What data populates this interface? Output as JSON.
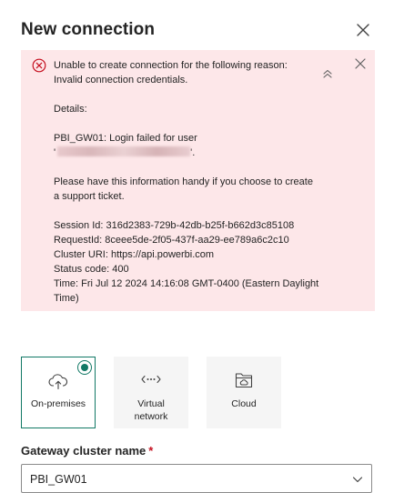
{
  "dialog": {
    "title": "New connection"
  },
  "error": {
    "lines": {
      "l1": "Unable to create connection for the following reason:",
      "l2": "Invalid connection credentials.",
      "details_label": "Details:",
      "login_failed": "PBI_GW01: Login failed for user",
      "login_user_prefix": "'",
      "login_user_suffix": "'.",
      "handy1": "Please have this information handy if you choose to create",
      "handy2": "a support ticket.",
      "session": "Session Id: 316d2383-729b-42db-b25f-b662d3c85108",
      "request": "RequestId: 8ceee5de-2f05-437f-aa29-ee789a6c2c10",
      "cluster": "Cluster URI: https://api.powerbi.com",
      "status": "Status code: 400",
      "time1": "Time: Fri Jul 12 2024 14:16:08 GMT-0400 (Eastern Daylight",
      "time2": "Time)"
    },
    "colors": {
      "background": "#fde7e9",
      "icon": "#c50f1f"
    }
  },
  "connection_types": {
    "selected": "On-premises",
    "options": [
      {
        "label": "On-premises",
        "icon": "cloud-upload-icon"
      },
      {
        "label_line1": "Virtual",
        "label_line2": "network",
        "icon": "network-arrows-icon"
      },
      {
        "label": "Cloud",
        "icon": "cloud-folder-icon"
      }
    ]
  },
  "gateway": {
    "label": "Gateway cluster name",
    "required_mark": "*",
    "value": "PBI_GW01"
  },
  "accent_color": "#117865"
}
